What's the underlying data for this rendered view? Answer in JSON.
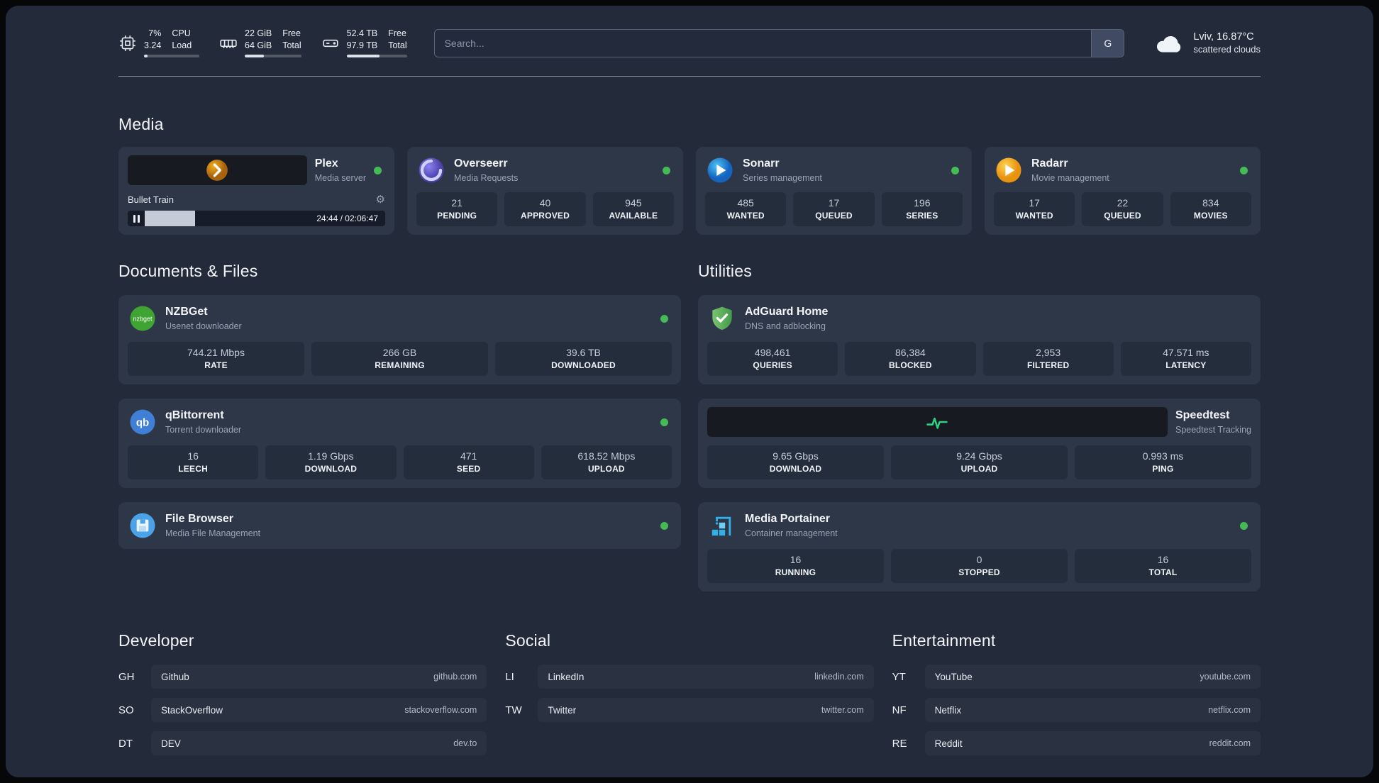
{
  "topbar": {
    "cpu": {
      "value_top": "7%",
      "value_bottom": "3.24",
      "label_top": "CPU",
      "label_bottom": "Load",
      "percent": 7
    },
    "ram": {
      "value_top": "22 GiB",
      "value_bottom": "64 GiB",
      "label_top": "Free",
      "label_bottom": "Total",
      "percent": 34
    },
    "disk": {
      "value_top": "52.4 TB",
      "value_bottom": "97.9 TB",
      "label_top": "Free",
      "label_bottom": "Total",
      "percent": 54
    },
    "search": {
      "placeholder": "Search...",
      "engine_label": "G"
    },
    "weather": {
      "location": "Lviv, 16.87°C",
      "condition": "scattered clouds"
    }
  },
  "media": {
    "title": "Media",
    "apps": [
      {
        "name": "Plex",
        "subtitle": "Media server",
        "player": {
          "track": "Bullet Train",
          "time": "24:44 / 02:06:47",
          "progress": 19.5
        }
      },
      {
        "name": "Overseerr",
        "subtitle": "Media Requests",
        "stats": [
          {
            "value": "21",
            "label": "PENDING"
          },
          {
            "value": "40",
            "label": "APPROVED"
          },
          {
            "value": "945",
            "label": "AVAILABLE"
          }
        ]
      },
      {
        "name": "Sonarr",
        "subtitle": "Series management",
        "stats": [
          {
            "value": "485",
            "label": "WANTED"
          },
          {
            "value": "17",
            "label": "QUEUED"
          },
          {
            "value": "196",
            "label": "SERIES"
          }
        ]
      },
      {
        "name": "Radarr",
        "subtitle": "Movie management",
        "stats": [
          {
            "value": "17",
            "label": "WANTED"
          },
          {
            "value": "22",
            "label": "QUEUED"
          },
          {
            "value": "834",
            "label": "MOVIES"
          }
        ]
      }
    ]
  },
  "documents": {
    "title": "Documents & Files",
    "apps": [
      {
        "name": "NZBGet",
        "subtitle": "Usenet downloader",
        "stats": [
          {
            "value": "744.21 Mbps",
            "label": "RATE"
          },
          {
            "value": "266 GB",
            "label": "REMAINING"
          },
          {
            "value": "39.6 TB",
            "label": "DOWNLOADED"
          }
        ]
      },
      {
        "name": "qBittorrent",
        "subtitle": "Torrent downloader",
        "stats": [
          {
            "value": "16",
            "label": "LEECH"
          },
          {
            "value": "1.19 Gbps",
            "label": "DOWNLOAD"
          },
          {
            "value": "471",
            "label": "SEED"
          },
          {
            "value": "618.52 Mbps",
            "label": "UPLOAD"
          }
        ]
      },
      {
        "name": "File Browser",
        "subtitle": "Media File Management",
        "stats": []
      }
    ]
  },
  "utilities": {
    "title": "Utilities",
    "apps": [
      {
        "name": "AdGuard Home",
        "subtitle": "DNS and adblocking",
        "stats": [
          {
            "value": "498,461",
            "label": "QUERIES"
          },
          {
            "value": "86,384",
            "label": "BLOCKED"
          },
          {
            "value": "2,953",
            "label": "FILTERED"
          },
          {
            "value": "47.571 ms",
            "label": "LATENCY"
          }
        ]
      },
      {
        "name": "Speedtest",
        "subtitle": "Speedtest Tracking",
        "stats": [
          {
            "value": "9.65 Gbps",
            "label": "DOWNLOAD"
          },
          {
            "value": "9.24 Gbps",
            "label": "UPLOAD"
          },
          {
            "value": "0.993 ms",
            "label": "PING"
          }
        ]
      },
      {
        "name": "Media Portainer",
        "subtitle": "Container management",
        "stats": [
          {
            "value": "16",
            "label": "RUNNING"
          },
          {
            "value": "0",
            "label": "STOPPED"
          },
          {
            "value": "16",
            "label": "TOTAL"
          }
        ]
      }
    ]
  },
  "bookmarks": {
    "groups": [
      {
        "title": "Developer",
        "links": [
          {
            "abbr": "GH",
            "name": "Github",
            "url": "github.com"
          },
          {
            "abbr": "SO",
            "name": "StackOverflow",
            "url": "stackoverflow.com"
          },
          {
            "abbr": "DT",
            "name": "DEV",
            "url": "dev.to"
          }
        ]
      },
      {
        "title": "Social",
        "links": [
          {
            "abbr": "LI",
            "name": "LinkedIn",
            "url": "linkedin.com"
          },
          {
            "abbr": "TW",
            "name": "Twitter",
            "url": "twitter.com"
          }
        ]
      },
      {
        "title": "Entertainment",
        "links": [
          {
            "abbr": "YT",
            "name": "YouTube",
            "url": "youtube.com"
          },
          {
            "abbr": "NF",
            "name": "Netflix",
            "url": "netflix.com"
          },
          {
            "abbr": "RE",
            "name": "Reddit",
            "url": "reddit.com"
          }
        ]
      }
    ]
  },
  "colors": {
    "status_online_green": "#44bb55",
    "accent_fill": "#dde2ea"
  }
}
